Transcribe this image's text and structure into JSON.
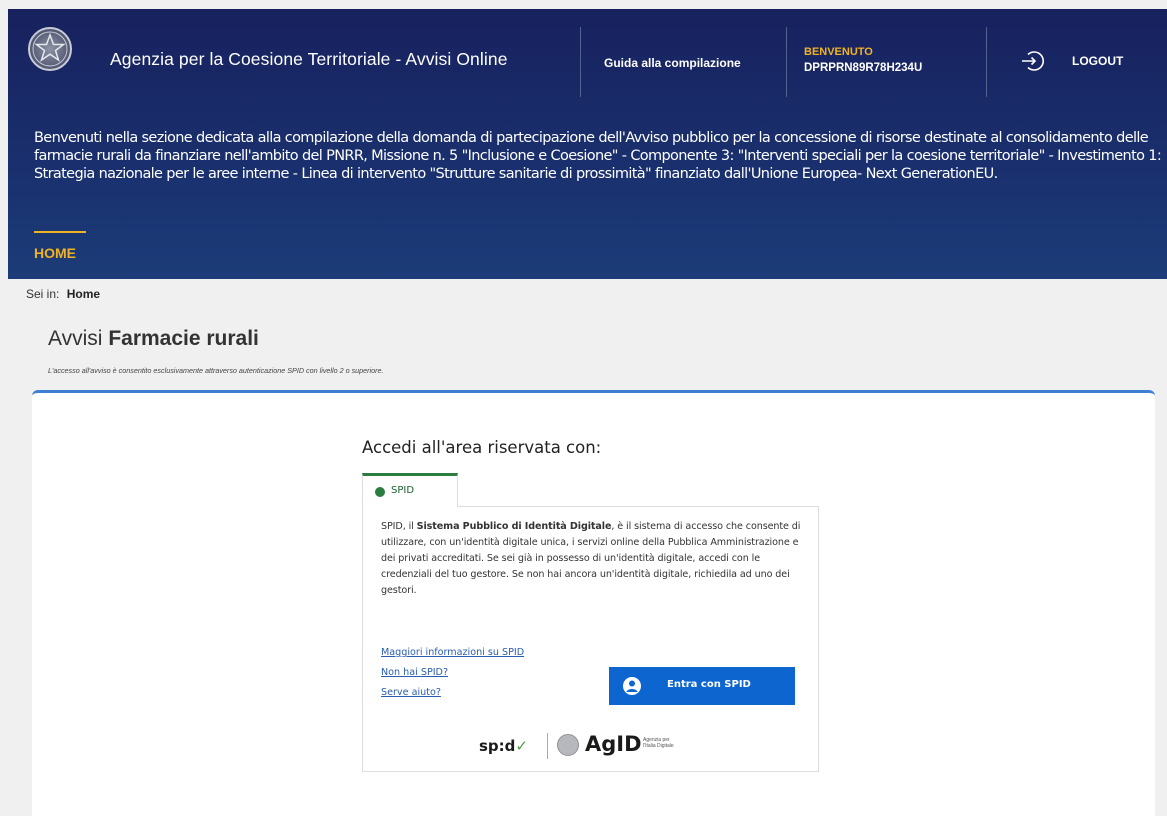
{
  "header": {
    "site_title": "Agenzia per la Coesione Territoriale - Avvisi Online",
    "guide_label": "Guida alla compilazione",
    "welcome_label": "BENVENUTO",
    "user_code": "DPRPRN89R78H234U",
    "logout_label": "LOGOUT"
  },
  "intro": {
    "text": "Benvenuti nella sezione dedicata alla compilazione della domanda di partecipazione dell'Avviso pubblico per la concessione di risorse destinate al consolidamento delle farmacie rurali da finanziare nell'ambito del PNRR, Missione n. 5 \"Inclusione e Coesione\" - Componente 3: \"Interventi speciali per la coesione territoriale\" - Investimento 1: Strategia nazionale per le aree interne - Linea di intervento \"Strutture sanitarie di prossimità\" finanziato dall'Unione Europea- Next GenerationEU."
  },
  "nav": {
    "home_label": "HOME"
  },
  "breadcrumb": {
    "prefix": "Sei in:",
    "current": "Home"
  },
  "page": {
    "title_light": "Avvisi",
    "title_bold": "Farmacie rurali",
    "note": "L'accesso all'avviso è consentito esclusivamente attraverso autenticazione SPID con livello 2 o superiore."
  },
  "login": {
    "title": "Accedi all'area riservata con:",
    "tab_label": "SPID",
    "desc_pre": "SPID, il ",
    "desc_bold": "Sistema Pubblico di Identità Digitale",
    "desc_post": ", è il sistema di accesso che consente di utilizzare, con un'identità digitale unica, i servizi online della Pubblica Amministrazione e dei privati accreditati. Se sei già in possesso di un'identità digitale, accedi con le credenziali del tuo gestore. Se non hai ancora un'identità digitale, richiedila ad uno dei gestori.",
    "link_info": "Maggiori informazioni su SPID",
    "link_no_spid": "Non hai SPID?",
    "link_help": "Serve aiuto?",
    "button_label": "Entra con SPID",
    "spid_logo": "sp:d",
    "agid_logo": "AgID",
    "agid_sub": "Agenzia per l'Italia Digitale"
  },
  "colors": {
    "header": "#1a2f6d",
    "accent": "#f0b323",
    "primary": "#0d66d0",
    "spid_green": "#2b7d3f"
  }
}
